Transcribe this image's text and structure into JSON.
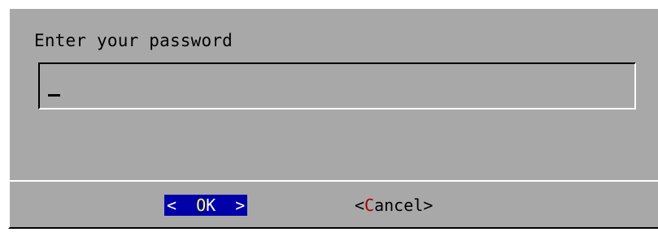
{
  "dialog": {
    "prompt": "Enter your password",
    "input": {
      "value": ""
    },
    "buttons": {
      "ok": {
        "open": "<  ",
        "hotkey": "O",
        "rest": "K",
        "close": "  >"
      },
      "cancel": {
        "open": "<",
        "hotkey": "C",
        "rest": "ancel",
        "close": ">"
      }
    }
  },
  "colors": {
    "dialog_bg": "#a8a8a8",
    "selected_bg": "#0000a8",
    "selected_fg": "#ffffff",
    "selected_hotkey": "#ffff55",
    "hotkey": "#a80000"
  }
}
